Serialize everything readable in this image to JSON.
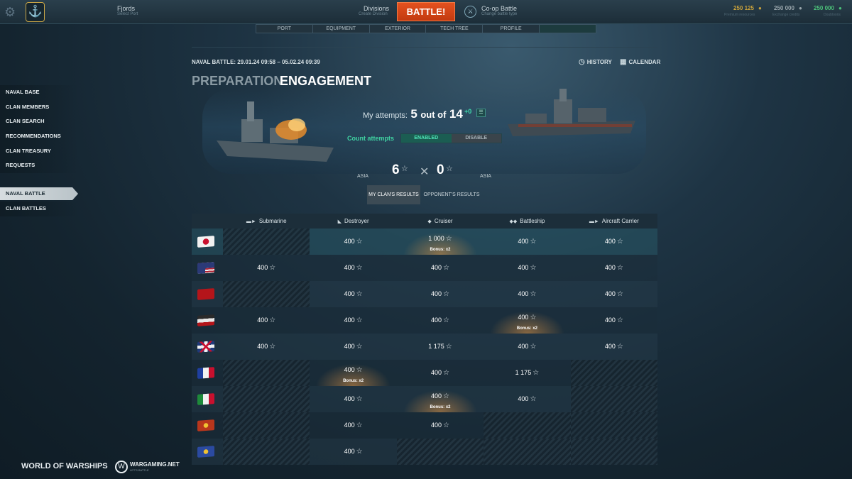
{
  "topbar": {
    "port_name": "Fjords",
    "port_sub": "Select Port",
    "divisions": "Divisions",
    "divisions_sub": "Create Division",
    "battle": "BATTLE!",
    "mode": "Co-op Battle",
    "mode_sub": "Change battle type",
    "resources": [
      {
        "value": "250 125",
        "label": "Premium resources",
        "color": "#c9a23c"
      },
      {
        "value": "250 000",
        "label": "Exchange credits",
        "color": "#9aa7ad"
      },
      {
        "value": "250 000",
        "label": "Doubloons",
        "color": "#4cc27a"
      }
    ]
  },
  "nav_tabs": [
    "PORT",
    "EQUIPMENT",
    "EXTERIOR",
    "TECH TREE",
    "PROFILE",
    ""
  ],
  "header": {
    "title": "NAVAL BATTLE: 29.01.24 09:58 – 05.02.24 09:39",
    "history": "HISTORY",
    "calendar": "CALENDAR",
    "tab_preparation": "PREPARATION",
    "tab_engagement": "ENGAGEMENT"
  },
  "battle": {
    "attempts_label": "My attempts:",
    "attempts_used": "5",
    "attempts_out_of": "out of",
    "attempts_total": "14",
    "attempts_bonus": "+0",
    "count_label": "Count attempts",
    "enabled": "ENABLED",
    "disable": "DISABLE",
    "left_clan": "ASIA",
    "right_clan": "ASIA",
    "left_score": "6",
    "right_score": "0",
    "my_results": "MY CLAN'S RESULTS",
    "opp_results": "OPPONENT'S RESULTS"
  },
  "sidebar": {
    "items": [
      "NAVAL BASE",
      "CLAN MEMBERS",
      "CLAN SEARCH",
      "RECOMMENDATIONS",
      "CLAN TREASURY",
      "REQUESTS"
    ],
    "active": "NAVAL BATTLE",
    "second": "CLAN BATTLES"
  },
  "table": {
    "columns": [
      "Submarine",
      "Destroyer",
      "Cruiser",
      "Battleship",
      "Aircraft Carrier"
    ],
    "bonus_label": "Bonus: x2",
    "rows": [
      {
        "nation": "japan",
        "cells": [
          null,
          "400",
          {
            "v": "1 000",
            "bonus": true
          },
          "400",
          "400"
        ]
      },
      {
        "nation": "usa",
        "cells": [
          "400",
          "400",
          "400",
          "400",
          "400"
        ]
      },
      {
        "nation": "ussr",
        "cells": [
          null,
          "400",
          "400",
          "400",
          "400"
        ]
      },
      {
        "nation": "germany",
        "cells": [
          "400",
          "400",
          "400",
          {
            "v": "400",
            "bonus": true
          },
          "400"
        ]
      },
      {
        "nation": "uk",
        "cells": [
          "400",
          "400",
          "1 175",
          "400",
          "400"
        ]
      },
      {
        "nation": "france",
        "cells": [
          null,
          {
            "v": "400",
            "bonus": true
          },
          "400",
          "1 175",
          null
        ]
      },
      {
        "nation": "italy",
        "cells": [
          null,
          "400",
          {
            "v": "400",
            "bonus": true
          },
          "400",
          null
        ]
      },
      {
        "nation": "pan-asia",
        "cells": [
          null,
          "400",
          "400",
          null,
          null
        ]
      },
      {
        "nation": "europe",
        "cells": [
          null,
          "400",
          null,
          null,
          null
        ]
      }
    ]
  },
  "footer": {
    "wows": "WORLD OF WARSHIPS",
    "wg": "WARGAMING.NET",
    "wg_sub": "LET'S BATTLE"
  }
}
